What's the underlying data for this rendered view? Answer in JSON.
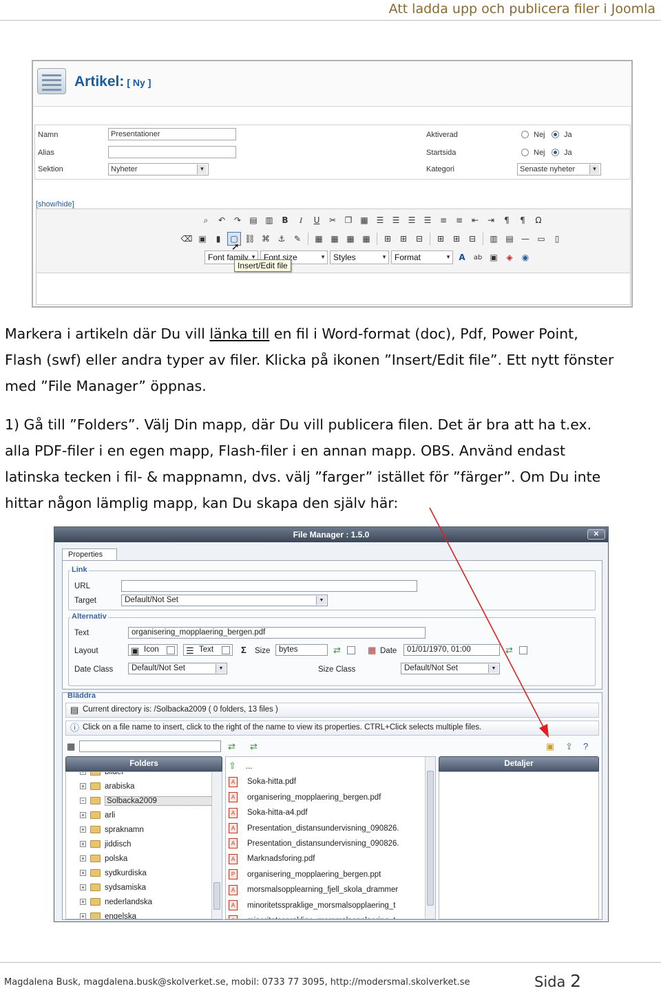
{
  "page_header": {
    "title": "Att ladda upp och publicera filer i Joomla"
  },
  "joomla": {
    "title": "Artikel:",
    "title_suffix": "[ Ny ]",
    "fields": {
      "namn_label": "Namn",
      "namn_value": "Presentationer",
      "alias_label": "Alias",
      "alias_value": "",
      "sektion_label": "Sektion",
      "sektion_value": "Nyheter",
      "aktiverad_label": "Aktiverad",
      "startsida_label": "Startsida",
      "kategori_label": "Kategori",
      "kategori_value": "Senaste nyheter",
      "nej_label": "Nej",
      "ja_label": "Ja"
    },
    "showhide": "[show/hide]",
    "toolbar": {
      "font_family": "Font family",
      "font_size": "Font size",
      "styles": "Styles",
      "format": "Format"
    },
    "tooltip": "Insert/Edit file"
  },
  "text": {
    "p1_line1_pre": "Markera i artikeln där Du vill ",
    "p1_line1_link": "länka till",
    "p1_line1_post": " en fil i Word-format (doc), Pdf, Power Point,",
    "p1_line2": "Flash (swf) eller andra typer av filer. Klicka på ikonen ”Insert/Edit file”. Ett nytt fönster",
    "p1_line3": "med ”File Manager” öppnas.",
    "p2_line1": "1) Gå till ”Folders”. Välj Din mapp, där Du vill publicera filen. Det är bra att ha t.ex.",
    "p2_line2": "alla PDF-filer i en egen mapp, Flash-filer i en annan mapp. OBS. Använd endast",
    "p2_line3": "latinska tecken i fil- & mappnamn, dvs. välj ”farger” istället för ”färger”. Om Du inte",
    "p2_line4": "hittar någon lämplig mapp, kan Du skapa den själv här:"
  },
  "file_manager": {
    "title": "File Manager : 1.5.0",
    "close_label": "✕",
    "properties_tab": "Properties",
    "link_legend": "Link",
    "url_label": "URL",
    "url_value": "",
    "target_label": "Target",
    "target_value": "Default/Not Set",
    "alternativ_legend": "Alternativ",
    "text_label": "Text",
    "text_value": "organisering_mopplaering_bergen.pdf",
    "layout_label": "Layout",
    "icon_label": "Icon",
    "text_option_label": "Text",
    "size_label": "Size",
    "size_value": "bytes",
    "date_label": "Date",
    "date_value": "01/01/1970, 01:00",
    "date_class_label": "Date Class",
    "date_class_value": "Default/Not Set",
    "size_class_label": "Size Class",
    "size_class_value": "Default/Not Set",
    "bladdra_legend": "Bläddra",
    "current_dir": "Current directory is: /Solbacka2009 ( 0 folders, 13 files )",
    "info": "Click on a file name to insert, click to the right of the name to view its properties. CTRL+Click selects multiple files.",
    "folders_header": "Folders",
    "details_header": "Detaljer",
    "folders": [
      "bilder",
      "arabiska",
      "Solbacka2009",
      "arli",
      "spraknamn",
      "jiddisch",
      "polska",
      "sydkurdiska",
      "sydsamiska",
      "nederlandska",
      "engelska"
    ],
    "files": [
      "...",
      "Soka-hitta.pdf",
      "organisering_mopplaering_bergen.pdf",
      "Soka-hitta-a4.pdf",
      "Presentation_distansundervisning_090826.",
      "Presentation_distansundervisning_090826.",
      "Marknadsforing.pdf",
      "organisering_mopplaering_bergen.ppt",
      "morsmalsopplearning_fjell_skola_drammer",
      "minoritetsspraklige_morsmalsopplaering_t",
      "minoritetsspraklige_morsmalsopplaering_t"
    ]
  },
  "footer": {
    "contact": "Magdalena Busk, magdalena.busk@skolverket.se,  mobil: 0733 77 3095, http://modersmal.skolverket.se",
    "page_label": "Sida",
    "page_number": "2"
  }
}
